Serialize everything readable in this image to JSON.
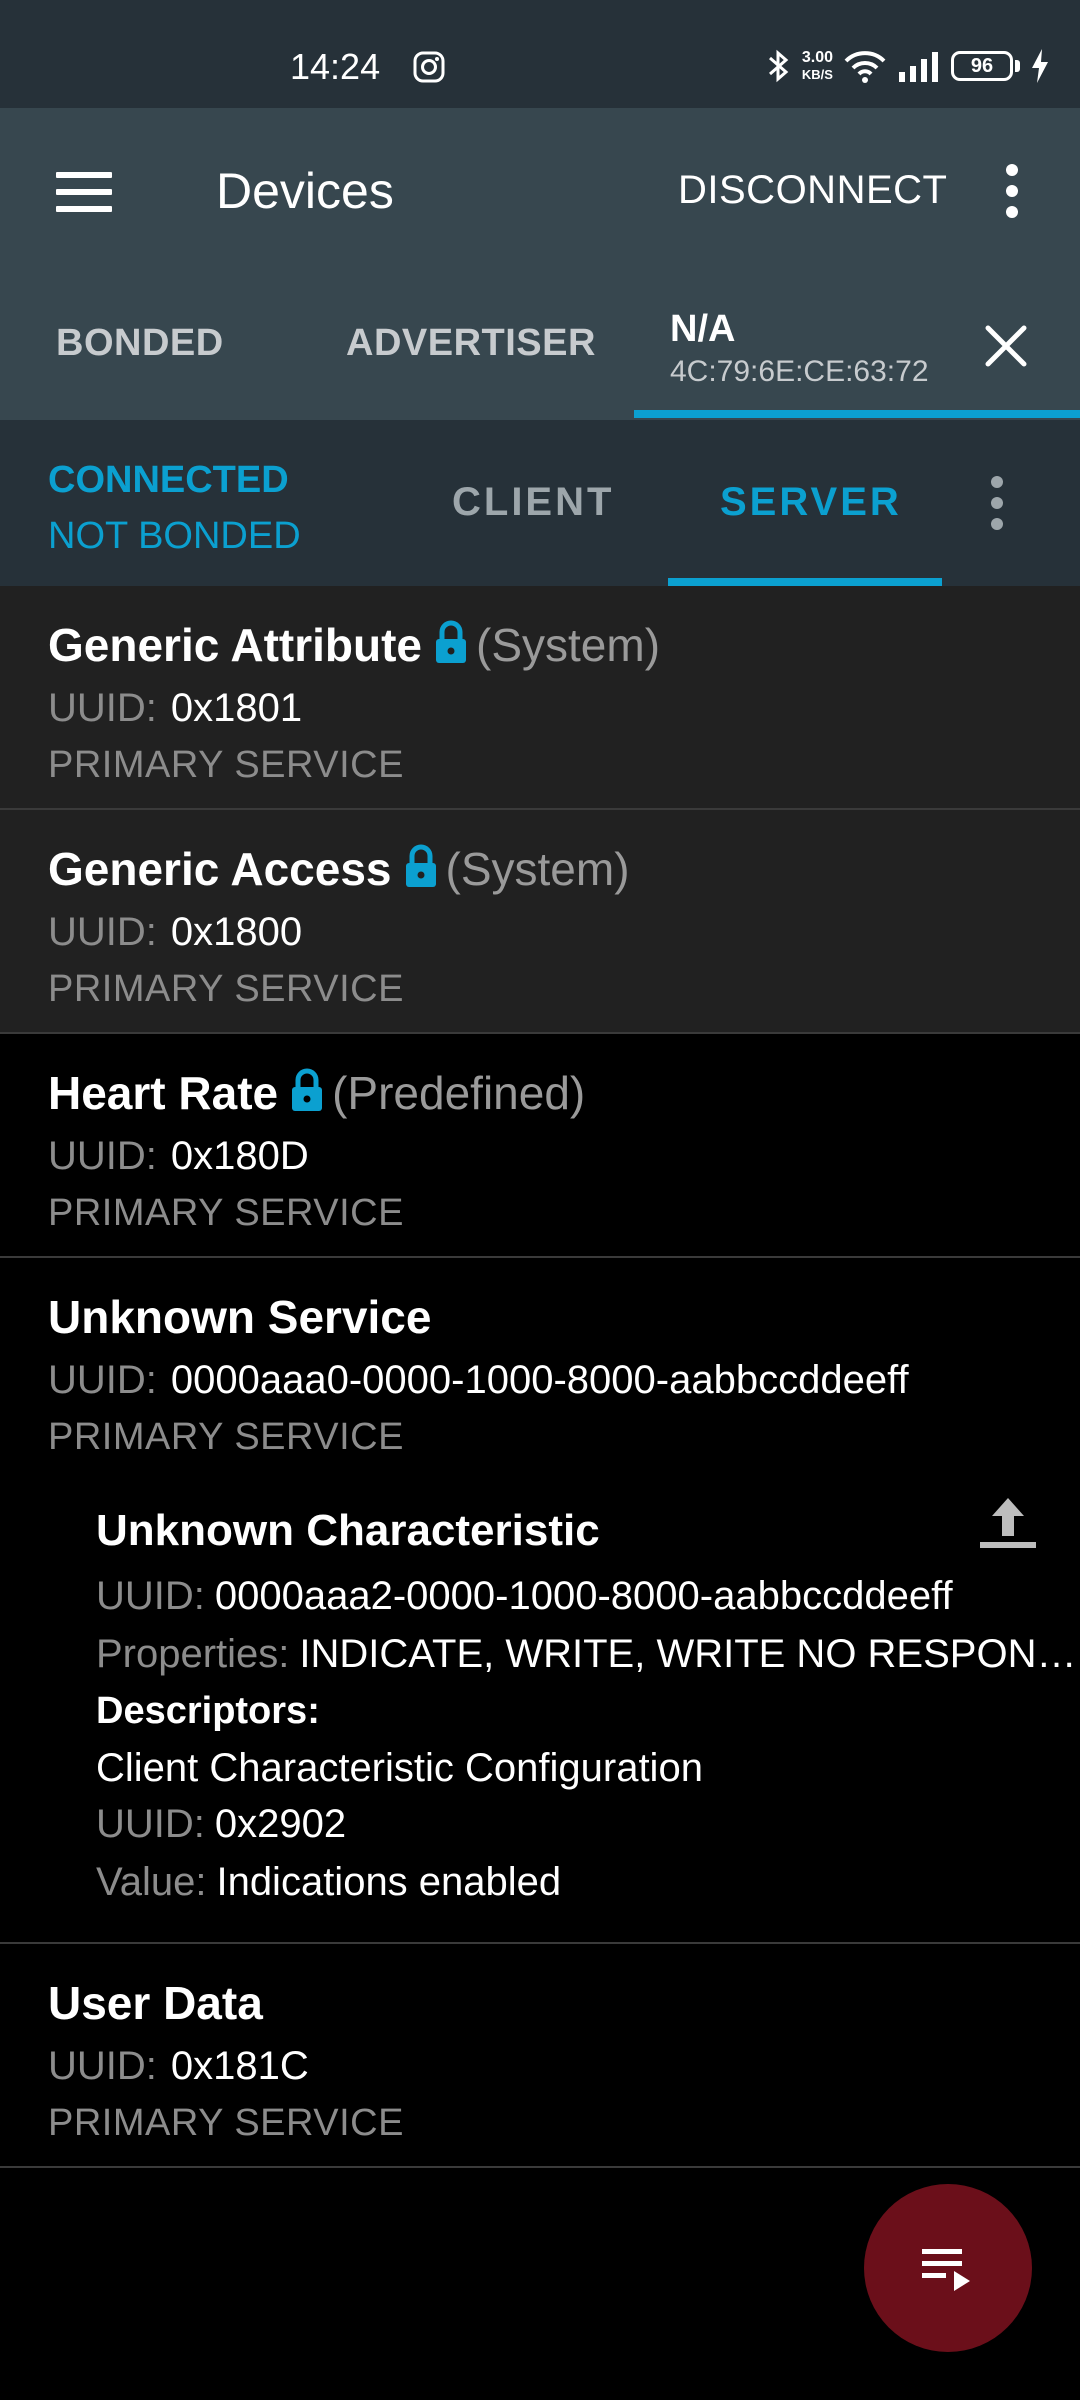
{
  "status_bar": {
    "time": "14:24",
    "net_speed_value": "3.00",
    "net_speed_unit": "KB/S",
    "battery": "96",
    "icons": [
      "instagram-icon",
      "bluetooth-icon",
      "wifi-icon",
      "signal-icon",
      "battery-icon",
      "charging-icon"
    ]
  },
  "toolbar": {
    "title": "Devices",
    "disconnect_label": "DISCONNECT"
  },
  "device_tabs": {
    "bonded": "BONDED",
    "advertiser": "ADVERTISER",
    "active_name": "N/A",
    "active_mac": "4C:79:6E:CE:63:72"
  },
  "connection": {
    "status": "CONNECTED",
    "bond_status": "NOT BONDED",
    "tab_client": "CLIENT",
    "tab_server": "SERVER"
  },
  "accent_color": "#0ba0d0",
  "uuid_label": "UUID:",
  "services": [
    {
      "name": "Generic Attribute",
      "tag": "(System)",
      "uuid": "0x1801",
      "type": "PRIMARY SERVICE"
    },
    {
      "name": "Generic Access",
      "tag": "(System)",
      "uuid": "0x1800",
      "type": "PRIMARY SERVICE"
    },
    {
      "name": "Heart Rate",
      "tag": "(Predefined)",
      "uuid": "0x180D",
      "type": "PRIMARY SERVICE"
    },
    {
      "name": "Unknown Service",
      "uuid": "0000aaa0-0000-1000-8000-aabbccddeeff",
      "type": "PRIMARY SERVICE",
      "characteristic": {
        "name": "Unknown Characteristic",
        "uuid": "0000aaa2-0000-1000-8000-aabbccddeeff",
        "properties_label": "Properties:",
        "properties": "INDICATE, WRITE, WRITE NO RESPON…",
        "descriptors_label": "Descriptors:",
        "descriptor_name": "Client Characteristic Configuration",
        "descriptor_uuid": "0x2902",
        "value_label": "Value:",
        "value": "Indications enabled"
      }
    },
    {
      "name": "User Data",
      "uuid": "0x181C",
      "type": "PRIMARY SERVICE"
    }
  ]
}
